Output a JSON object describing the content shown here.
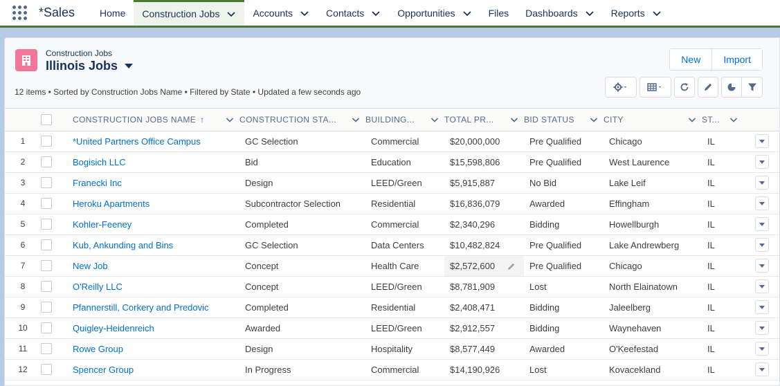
{
  "nav": {
    "app_name": "*Sales",
    "items": [
      {
        "label": "Home",
        "dropdown": false
      },
      {
        "label": "Construction Jobs",
        "dropdown": true,
        "active": true
      },
      {
        "label": "Accounts",
        "dropdown": true
      },
      {
        "label": "Contacts",
        "dropdown": true
      },
      {
        "label": "Opportunities",
        "dropdown": true
      },
      {
        "label": "Files",
        "dropdown": false
      },
      {
        "label": "Dashboards",
        "dropdown": true
      },
      {
        "label": "Reports",
        "dropdown": true
      }
    ]
  },
  "header": {
    "object_label": "Construction Jobs",
    "list_title": "Illinois Jobs",
    "new_label": "New",
    "import_label": "Import",
    "meta_text": "12 items • Sorted by Construction Jobs Name • Filtered by State • Updated a few seconds ago",
    "icon": "building-icon"
  },
  "toolbar_icons": [
    "gear-icon",
    "table-icon",
    "refresh-icon",
    "pencil-icon",
    "pie-chart-icon",
    "filter-icon"
  ],
  "columns": [
    {
      "label": "Construction Jobs Name",
      "sorted": true
    },
    {
      "label": "Construction Sta...",
      "sorted": false
    },
    {
      "label": "Building...",
      "sorted": false
    },
    {
      "label": "Total Pr...",
      "sorted": false
    },
    {
      "label": "Bid Status",
      "sorted": false
    },
    {
      "label": "City",
      "sorted": false
    },
    {
      "label": "St...",
      "sorted": false
    }
  ],
  "rows": [
    {
      "num": "1",
      "name": "*United Partners Office Campus",
      "stage": "GC Selection",
      "building": "Commercial",
      "total": "$20,000,000",
      "bid": "Pre Qualified",
      "city": "Chicago",
      "state": "IL"
    },
    {
      "num": "2",
      "name": "Bogisich LLC",
      "stage": "Bid",
      "building": "Education",
      "total": "$15,598,806",
      "bid": "Pre Qualified",
      "city": "West Laurence",
      "state": "IL"
    },
    {
      "num": "3",
      "name": "Franecki Inc",
      "stage": "Design",
      "building": "LEED/Green",
      "total": "$5,915,887",
      "bid": "No Bid",
      "city": "Lake Leif",
      "state": "IL"
    },
    {
      "num": "4",
      "name": "Heroku Apartments",
      "stage": "Subcontractor Selection",
      "building": "Residential",
      "total": "$16,836,079",
      "bid": "Awarded",
      "city": "Effingham",
      "state": "IL"
    },
    {
      "num": "5",
      "name": "Kohler-Feeney",
      "stage": "Completed",
      "building": "Commercial",
      "total": "$2,340,296",
      "bid": "Bidding",
      "city": "Howellburgh",
      "state": "IL"
    },
    {
      "num": "6",
      "name": "Kub, Ankunding and Bins",
      "stage": "GC Selection",
      "building": "Data Centers",
      "total": "$10,482,824",
      "bid": "Pre Qualified",
      "city": "Lake Andrewberg",
      "state": "IL"
    },
    {
      "num": "7",
      "name": "New Job",
      "stage": "Concept",
      "building": "Health Care",
      "total": "$2,572,600",
      "bid": "Pre Qualified",
      "city": "Chicago",
      "state": "IL",
      "hover_edit": true
    },
    {
      "num": "8",
      "name": "O'Reilly LLC",
      "stage": "Concept",
      "building": "LEED/Green",
      "total": "$8,781,909",
      "bid": "Lost",
      "city": "North Elainatown",
      "state": "IL"
    },
    {
      "num": "9",
      "name": "Pfannerstill, Corkery and Predovic",
      "stage": "Completed",
      "building": "Residential",
      "total": "$2,408,471",
      "bid": "Bidding",
      "city": "Jaleelberg",
      "state": "IL"
    },
    {
      "num": "10",
      "name": "Quigley-Heidenreich",
      "stage": "Awarded",
      "building": "LEED/Green",
      "total": "$2,912,557",
      "bid": "Bidding",
      "city": "Waynehaven",
      "state": "IL"
    },
    {
      "num": "11",
      "name": "Rowe Group",
      "stage": "Design",
      "building": "Hospitality",
      "total": "$8,577,449",
      "bid": "Awarded",
      "city": "O'Keefestad",
      "state": "IL"
    },
    {
      "num": "12",
      "name": "Spencer Group",
      "stage": "In Progress",
      "building": "Commercial",
      "total": "$14,190,926",
      "bid": "Lost",
      "city": "Kovacekland",
      "state": "IL"
    }
  ]
}
